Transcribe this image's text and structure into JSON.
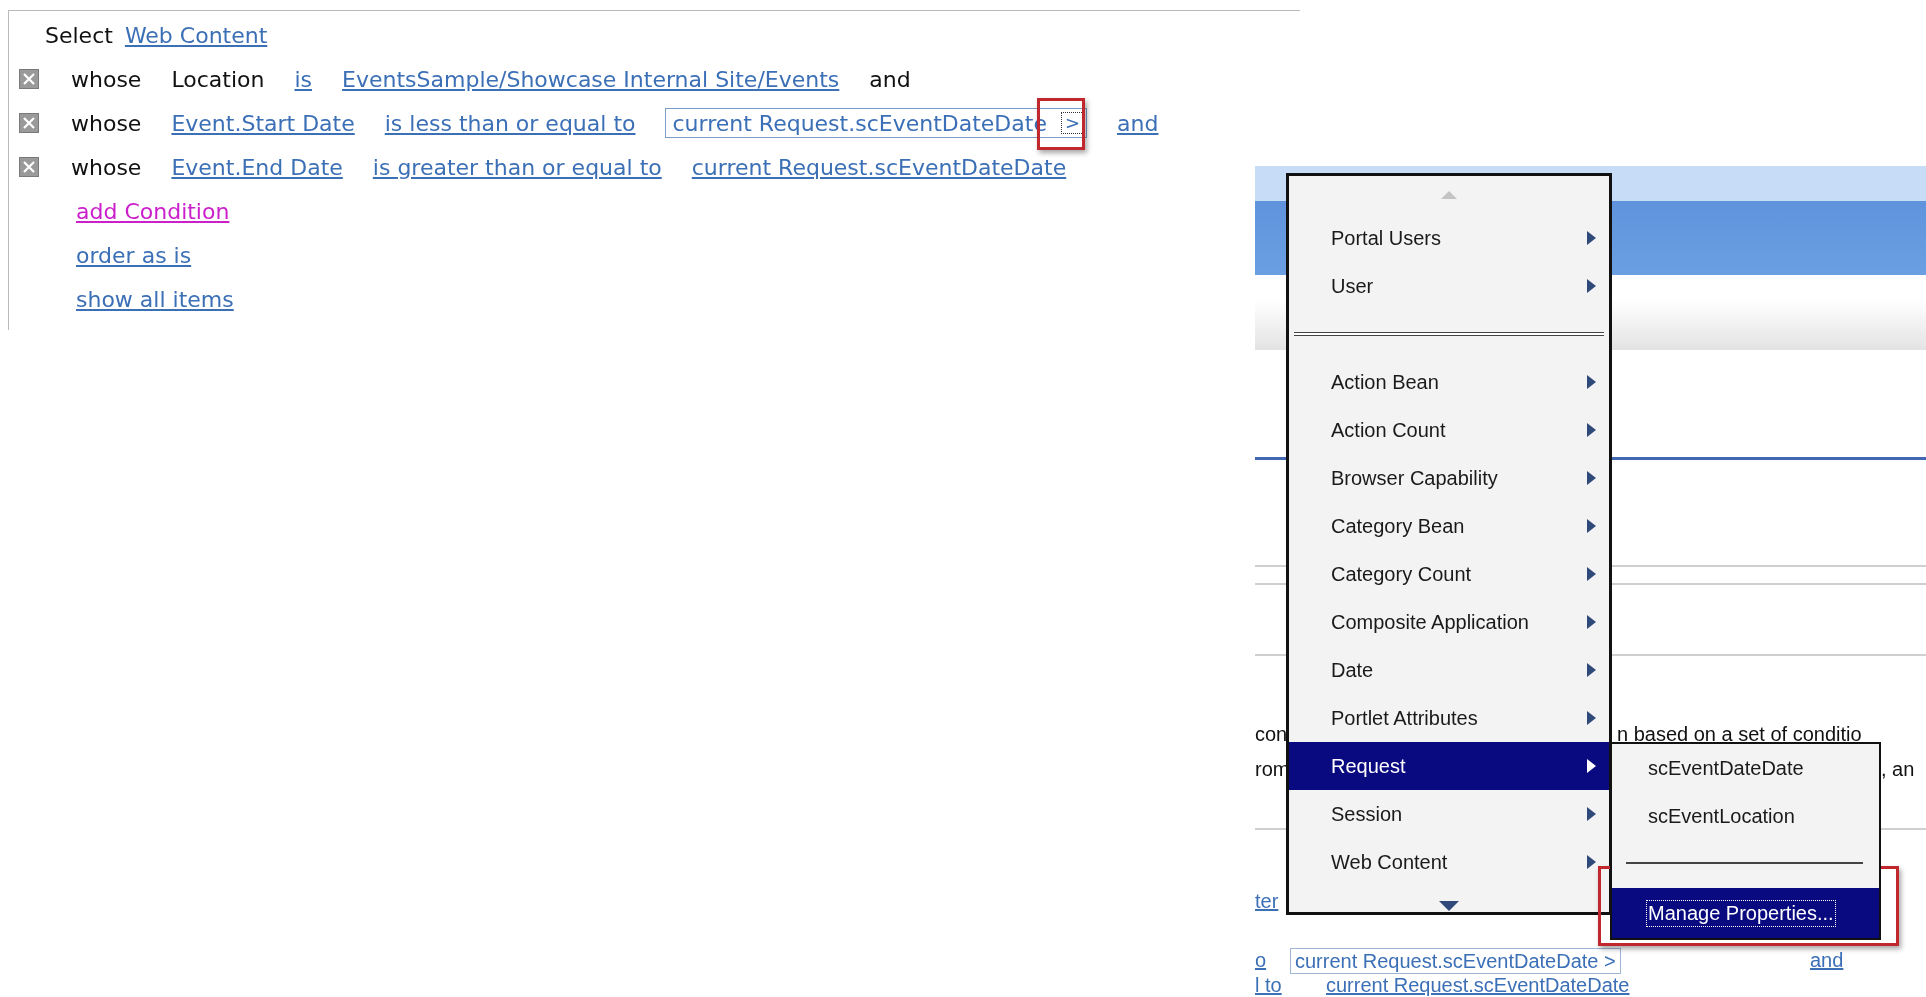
{
  "rule_editor": {
    "select_label": "Select",
    "select_value": "Web Content",
    "conditions": [
      {
        "prefix": "whose",
        "parts": [
          {
            "kind": "plain",
            "text": "Location"
          },
          {
            "kind": "link",
            "text": "is"
          },
          {
            "kind": "link",
            "text": "EventsSample/Showcase Internal Site/Events"
          },
          {
            "kind": "plain",
            "text": "and"
          }
        ]
      },
      {
        "prefix": "whose",
        "parts": [
          {
            "kind": "link",
            "text": "Event.Start Date"
          },
          {
            "kind": "link",
            "text": "is less than or equal to"
          },
          {
            "kind": "field",
            "text": "current Request.scEventDateDate",
            "button": ">",
            "highlighted": true
          },
          {
            "kind": "link",
            "text": "and"
          }
        ]
      },
      {
        "prefix": "whose",
        "parts": [
          {
            "kind": "link",
            "text": "Event.End Date"
          },
          {
            "kind": "link",
            "text": "is greater than or equal to"
          },
          {
            "kind": "link",
            "text": "current Request.scEventDateDate"
          }
        ]
      }
    ],
    "actions": [
      {
        "label": "add Condition",
        "visited": true
      },
      {
        "label": "order as is",
        "visited": false
      },
      {
        "label": "show all items",
        "visited": false
      }
    ]
  },
  "background_page": {
    "fragments": [
      {
        "kind": "plain",
        "text": "con"
      },
      {
        "kind": "plain",
        "text": "n based on a set of conditio"
      },
      {
        "kind": "plain",
        "text": "rom"
      },
      {
        "kind": "plain",
        "text": ", an"
      },
      {
        "kind": "link",
        "text": "ter"
      },
      {
        "kind": "link",
        "text": "o"
      },
      {
        "kind": "field",
        "text": "current Request.scEventDateDate >"
      },
      {
        "kind": "link",
        "text": "and"
      },
      {
        "kind": "link",
        "text": "l to"
      },
      {
        "kind": "link",
        "text": "current Request.scEventDateDate"
      }
    ]
  },
  "menu": {
    "items": [
      {
        "kind": "item",
        "label": "Portal Users",
        "selected": false
      },
      {
        "kind": "item",
        "label": "User",
        "selected": false
      },
      {
        "kind": "separator"
      },
      {
        "kind": "item",
        "label": "Action Bean",
        "selected": false
      },
      {
        "kind": "item",
        "label": "Action Count",
        "selected": false
      },
      {
        "kind": "item",
        "label": "Browser Capability",
        "selected": false
      },
      {
        "kind": "item",
        "label": "Category Bean",
        "selected": false
      },
      {
        "kind": "item",
        "label": "Category Count",
        "selected": false
      },
      {
        "kind": "item",
        "label": "Composite Application",
        "selected": false
      },
      {
        "kind": "item",
        "label": "Date",
        "selected": false
      },
      {
        "kind": "item",
        "label": "Portlet Attributes",
        "selected": false
      },
      {
        "kind": "item",
        "label": "Request",
        "selected": true
      },
      {
        "kind": "item",
        "label": "Session",
        "selected": false
      },
      {
        "kind": "item",
        "label": "Web Content",
        "selected": false
      }
    ]
  },
  "submenu": {
    "items": [
      {
        "kind": "item",
        "label": "scEventDateDate",
        "selected": false
      },
      {
        "kind": "item",
        "label": "scEventLocation",
        "selected": false
      },
      {
        "kind": "separator"
      },
      {
        "kind": "item",
        "label": "Manage Properties...",
        "selected": true,
        "highlighted": true
      }
    ]
  }
}
